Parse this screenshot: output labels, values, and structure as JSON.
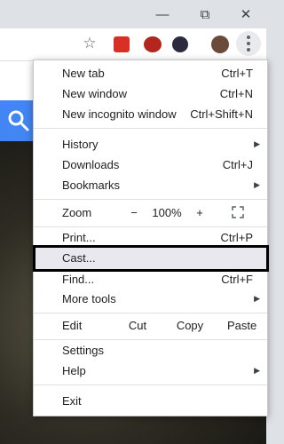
{
  "window": {
    "minimize": "—",
    "restore": "⧉",
    "close": "✕"
  },
  "toolbar": {
    "star": "☆"
  },
  "menu": {
    "new_tab": {
      "label": "New tab",
      "shortcut": "Ctrl+T"
    },
    "new_window": {
      "label": "New window",
      "shortcut": "Ctrl+N"
    },
    "new_incognito": {
      "label": "New incognito window",
      "shortcut": "Ctrl+Shift+N"
    },
    "history": {
      "label": "History"
    },
    "downloads": {
      "label": "Downloads",
      "shortcut": "Ctrl+J"
    },
    "bookmarks": {
      "label": "Bookmarks"
    },
    "zoom": {
      "label": "Zoom",
      "minus": "−",
      "value": "100%",
      "plus": "+"
    },
    "print": {
      "label": "Print...",
      "shortcut": "Ctrl+P"
    },
    "cast": {
      "label": "Cast..."
    },
    "find": {
      "label": "Find...",
      "shortcut": "Ctrl+F"
    },
    "more_tools": {
      "label": "More tools"
    },
    "edit": {
      "label": "Edit",
      "cut": "Cut",
      "copy": "Copy",
      "paste": "Paste"
    },
    "settings": {
      "label": "Settings"
    },
    "help": {
      "label": "Help"
    },
    "exit": {
      "label": "Exit"
    }
  },
  "colors": {
    "accent": "#4285f4",
    "highlight": "#e8e8ee"
  },
  "icons": [
    "search-icon",
    "star-icon",
    "menu-kebab-icon",
    "fullscreen-icon",
    "chevron-right-icon"
  ]
}
